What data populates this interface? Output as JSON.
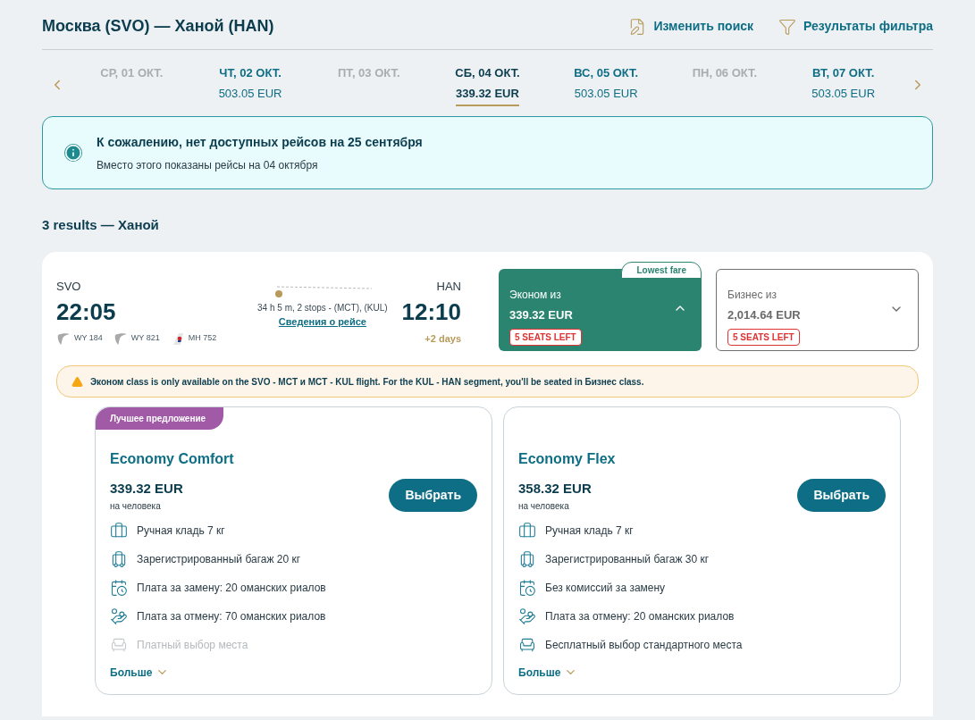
{
  "header": {
    "title": "Москва (SVO) — Ханой (HAN)",
    "actions": [
      {
        "kind": "edit",
        "label": "Изменить поиск"
      },
      {
        "kind": "filter",
        "label": "Результаты фильтра"
      }
    ]
  },
  "dates": [
    {
      "label": "СР, 01 ОКТ.",
      "selected": false,
      "disabled": true
    },
    {
      "label": "ЧТ, 02 ОКТ.",
      "price": "503.05 EUR",
      "selected": false,
      "disabled": false
    },
    {
      "label": "ПТ, 03 ОКТ.",
      "selected": false,
      "disabled": true
    },
    {
      "label": "СБ, 04 ОКТ.",
      "price": "339.32 EUR",
      "selected": true,
      "disabled": false
    },
    {
      "label": "ВС, 05 ОКТ.",
      "price": "503.05 EUR",
      "selected": false,
      "disabled": false
    },
    {
      "label": "ПН, 06 ОКТ.",
      "selected": false,
      "disabled": true
    },
    {
      "label": "ВТ, 07 ОКТ.",
      "price": "503.05 EUR",
      "selected": false,
      "disabled": false
    }
  ],
  "notice": {
    "title": "К сожалению, нет доступных рейсов на 25 сентября",
    "text": "Вместо этого показаны рейсы на 04 октября"
  },
  "results_title": "3 results — Ханой",
  "flight": {
    "from": "SVO",
    "depart": "22:05",
    "to": "HAN",
    "arrive": "12:10",
    "day_offset": "+2 days",
    "duration": "34 h 5 m, 2 stops - (MCT), (KUL)",
    "details_link": "Сведения о рейсе",
    "segments": [
      {
        "kind": "wing",
        "code": "WY 184"
      },
      {
        "kind": "wing",
        "code": "WY 821"
      },
      {
        "kind": "tail",
        "code": "MH 752"
      }
    ],
    "fares": [
      {
        "label": "Эконом из",
        "price": "339.32 EUR",
        "seats": "5 SEATS LEFT",
        "badge": "Lowest fare",
        "selected": true
      },
      {
        "label": "Бизнес из",
        "price": "2,014.64 EUR",
        "seats": "5 SEATS LEFT",
        "selected": false
      }
    ]
  },
  "warning": "Эконом class is only available on the SVO - MCT и MCT - KUL flight. For the KUL - HAN segment, you'll be seated in Бизнес class.",
  "options": [
    {
      "ribbon": "Лучшее предложение",
      "name": "Economy Comfort",
      "price": "339.32 EUR",
      "per": "на человека",
      "button": "Выбрать",
      "more": "Больше",
      "features": [
        {
          "kind": "cabin",
          "text": "Ручная кладь 7 кг",
          "disabled": false
        },
        {
          "kind": "baggage",
          "text": "Зарегистрированный багаж 20 кг",
          "disabled": false
        },
        {
          "kind": "change",
          "text": "Плата за замену: 20 оманских риалов",
          "disabled": false
        },
        {
          "kind": "cancel",
          "text": "Плата за отмену: 70 оманских риалов",
          "disabled": false
        },
        {
          "kind": "seat",
          "text": "Платный выбор места",
          "disabled": true
        }
      ]
    },
    {
      "name": "Economy Flex",
      "price": "358.32 EUR",
      "per": "на человека",
      "button": "Выбрать",
      "more": "Больше",
      "features": [
        {
          "kind": "cabin",
          "text": "Ручная кладь 7 кг",
          "disabled": false
        },
        {
          "kind": "baggage",
          "text": "Зарегистрированный багаж 30 кг",
          "disabled": false
        },
        {
          "kind": "change",
          "text": "Без комиссий за замену",
          "disabled": false
        },
        {
          "kind": "cancel",
          "text": "Плата за отмену: 20 оманских риалов",
          "disabled": false
        },
        {
          "kind": "seat",
          "text": "Бесплатный выбор стандартного места",
          "disabled": false
        }
      ]
    }
  ]
}
